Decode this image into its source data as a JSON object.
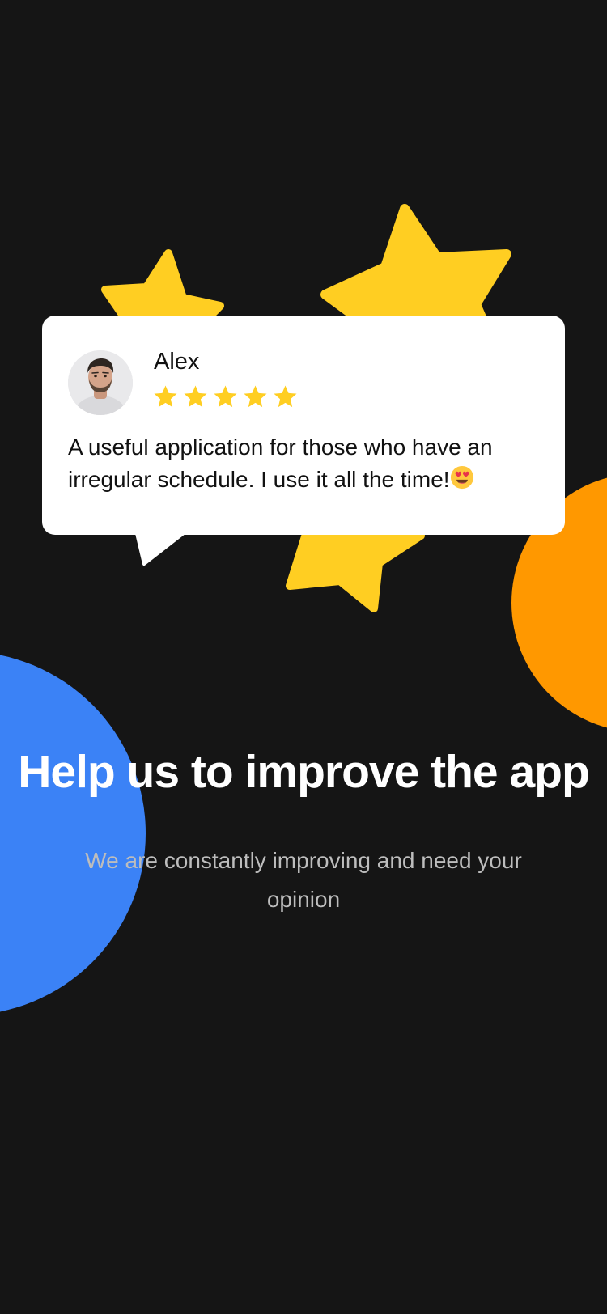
{
  "review": {
    "name": "Alex",
    "rating": 5,
    "text": "A useful application for those who have an irregular schedule. I use it all the time!",
    "emoji": "smiling-face-with-heart-eyes"
  },
  "onboarding": {
    "title": "Help us to improve the app",
    "subtitle": "We are constantly improving and need your opinion"
  },
  "colors": {
    "background": "#151515",
    "star_yellow": "#FFCE22",
    "orange": "#FF9800",
    "blue": "#3B82F6",
    "card": "#FFFFFF"
  }
}
